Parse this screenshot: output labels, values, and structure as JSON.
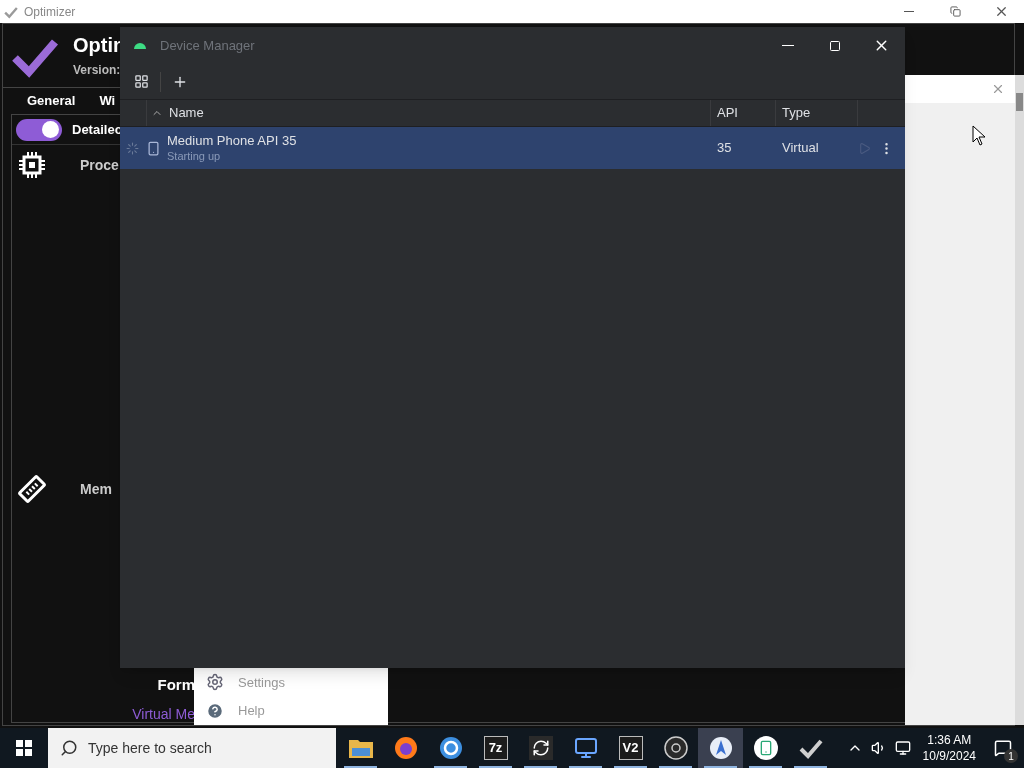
{
  "optimizer": {
    "title": "Optimizer",
    "app_name": "Optin",
    "version_label": "Version:",
    "tabs": [
      {
        "label": "General"
      },
      {
        "label": "Wi"
      }
    ],
    "toggle": {
      "label": "Detailec",
      "on": true
    },
    "sections": [
      {
        "kind": "chip",
        "label": "Proce"
      },
      {
        "kind": "memory",
        "label": "Mem"
      }
    ],
    "footer_label": "Form",
    "footer_link": "Virtual Me"
  },
  "popup_menu": {
    "items": [
      {
        "kind": "gear",
        "label": "Settings"
      },
      {
        "kind": "help",
        "label": "Help"
      }
    ]
  },
  "device_manager": {
    "title": "Device Manager",
    "columns": [
      {
        "label": "Name",
        "sorted": true
      },
      {
        "label": "API",
        "sorted": false
      },
      {
        "label": "Type",
        "sorted": false
      }
    ],
    "rows": [
      {
        "name": "Medium Phone API 35",
        "status": "Starting up",
        "api": "35",
        "type": "Virtual",
        "selected": true
      }
    ]
  },
  "taskbar": {
    "search_placeholder": "Type here to search",
    "apps": [
      {
        "kind": "folder",
        "running": true,
        "selected": false
      },
      {
        "kind": "firefox",
        "running": false,
        "selected": false
      },
      {
        "kind": "browser",
        "running": true,
        "selected": false
      },
      {
        "kind": "text",
        "label": "7z",
        "running": true,
        "selected": false
      },
      {
        "kind": "sync",
        "running": true,
        "selected": false
      },
      {
        "kind": "computer",
        "running": true,
        "selected": false
      },
      {
        "kind": "text",
        "label": "V2",
        "running": true,
        "selected": false
      },
      {
        "kind": "camera",
        "running": true,
        "selected": false
      },
      {
        "kind": "studio",
        "running": true,
        "selected": true
      },
      {
        "kind": "phone",
        "running": true,
        "selected": false
      },
      {
        "kind": "check",
        "running": true,
        "selected": false
      }
    ],
    "time": "1:36 AM",
    "date": "10/9/2024",
    "notification_count": "1"
  }
}
